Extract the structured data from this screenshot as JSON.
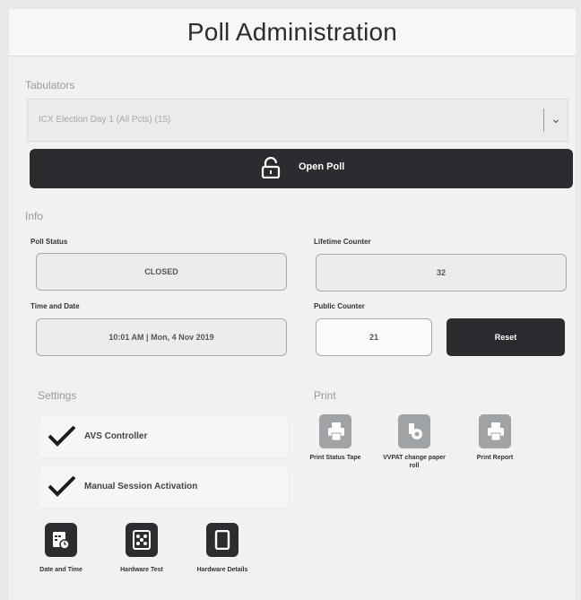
{
  "title": "Poll Administration",
  "tabulators": {
    "section_label": "Tabulators",
    "selected": "ICX Election Day 1 (All Pcts) (15)"
  },
  "open_poll_label": "Open Poll",
  "info": {
    "section_label": "Info",
    "poll_status_label": "Poll Status",
    "poll_status_value": "CLOSED",
    "lifetime_counter_label": "Lifetime Counter",
    "lifetime_counter_value": "32",
    "time_date_label": "Time and Date",
    "time_date_value": "10:01 AM | Mon, 4 Nov 2019",
    "public_counter_label": "Public Counter",
    "public_counter_value": "21",
    "reset_label": "Reset"
  },
  "settings": {
    "section_label": "Settings",
    "items": [
      {
        "label": "AVS Controller",
        "checked": true
      },
      {
        "label": "Manual Session Activation",
        "checked": true
      }
    ],
    "buttons": [
      {
        "label": "Date and Time",
        "icon": "calendar-clock-icon"
      },
      {
        "label": "Hardware Test",
        "icon": "hardware-test-icon"
      },
      {
        "label": "Hardware Details",
        "icon": "device-icon"
      }
    ]
  },
  "print": {
    "section_label": "Print",
    "buttons": [
      {
        "label": "Print Status Tape",
        "icon": "printer-icon"
      },
      {
        "label": "VVPAT change paper roll",
        "icon": "paper-roll-icon"
      },
      {
        "label": "Print Report",
        "icon": "printer-icon"
      }
    ]
  },
  "colors": {
    "dark_button": "#2b2c30",
    "disabled_button": "#a0a3a6",
    "background": "#f1f1ef"
  }
}
